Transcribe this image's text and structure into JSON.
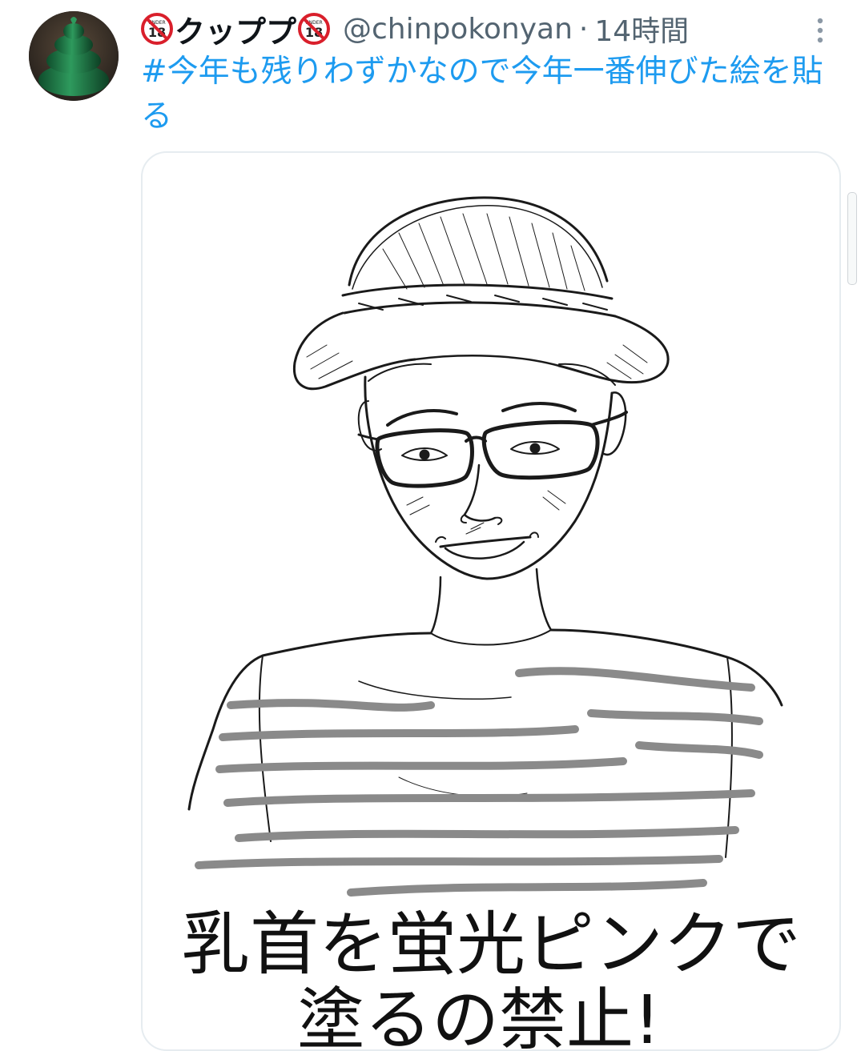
{
  "tweet": {
    "display_name": "クッププ",
    "handle": "@chinpokonyan",
    "separator": "·",
    "timestamp": "14時間",
    "text": "#今年も残りわずかなので今年一番伸びた絵を貼る",
    "name_badge_icon": "under-18-prohibited-icon",
    "name_badge_label": "UNDER"
  },
  "media": {
    "caption_line1": "乳首を蛍光ピンクで",
    "caption_line2": "塗るの禁止!"
  },
  "colors": {
    "link": "#1d9bf0",
    "secondary_text": "#536471",
    "badge_red": "#d91f2b",
    "avatar_green": "#1f7a4a"
  }
}
